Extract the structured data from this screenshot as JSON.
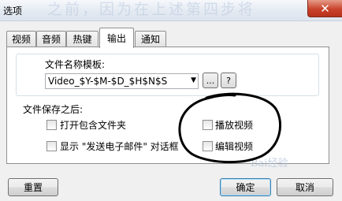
{
  "window": {
    "title": "选项",
    "title_overlay_text": "之前，因为在上述第四步将",
    "close_glyph": "✕"
  },
  "tabs": [
    {
      "label": "视频",
      "active": false
    },
    {
      "label": "音频",
      "active": false
    },
    {
      "label": "热键",
      "active": false
    },
    {
      "label": "输出",
      "active": true
    },
    {
      "label": "通知",
      "active": false
    }
  ],
  "output": {
    "template_label": "文件名称模板:",
    "template_value": "Video_$Y-$M-$D_$H$N$S",
    "browse_label": "...",
    "help_label": "?",
    "after_save_label": "文件保存之后:",
    "options": [
      {
        "label": "打开包含文件夹",
        "checked": false
      },
      {
        "label": "显示 \"发送电子邮件\" 对话框",
        "checked": false
      },
      {
        "label": "播放视频",
        "checked": false
      },
      {
        "label": "编辑视频",
        "checked": false
      }
    ]
  },
  "buttons": {
    "reset": "重置",
    "ok": "确定",
    "cancel": "取消"
  },
  "watermark": "Bai经验",
  "colors": {
    "close_button": "#c9432b",
    "panel_background": "#ffffff",
    "dialog_background": "#f0f0f0",
    "annotation_ink": "#000000"
  },
  "icons": {
    "dropdown": "chevron-down-icon",
    "close": "close-icon"
  }
}
